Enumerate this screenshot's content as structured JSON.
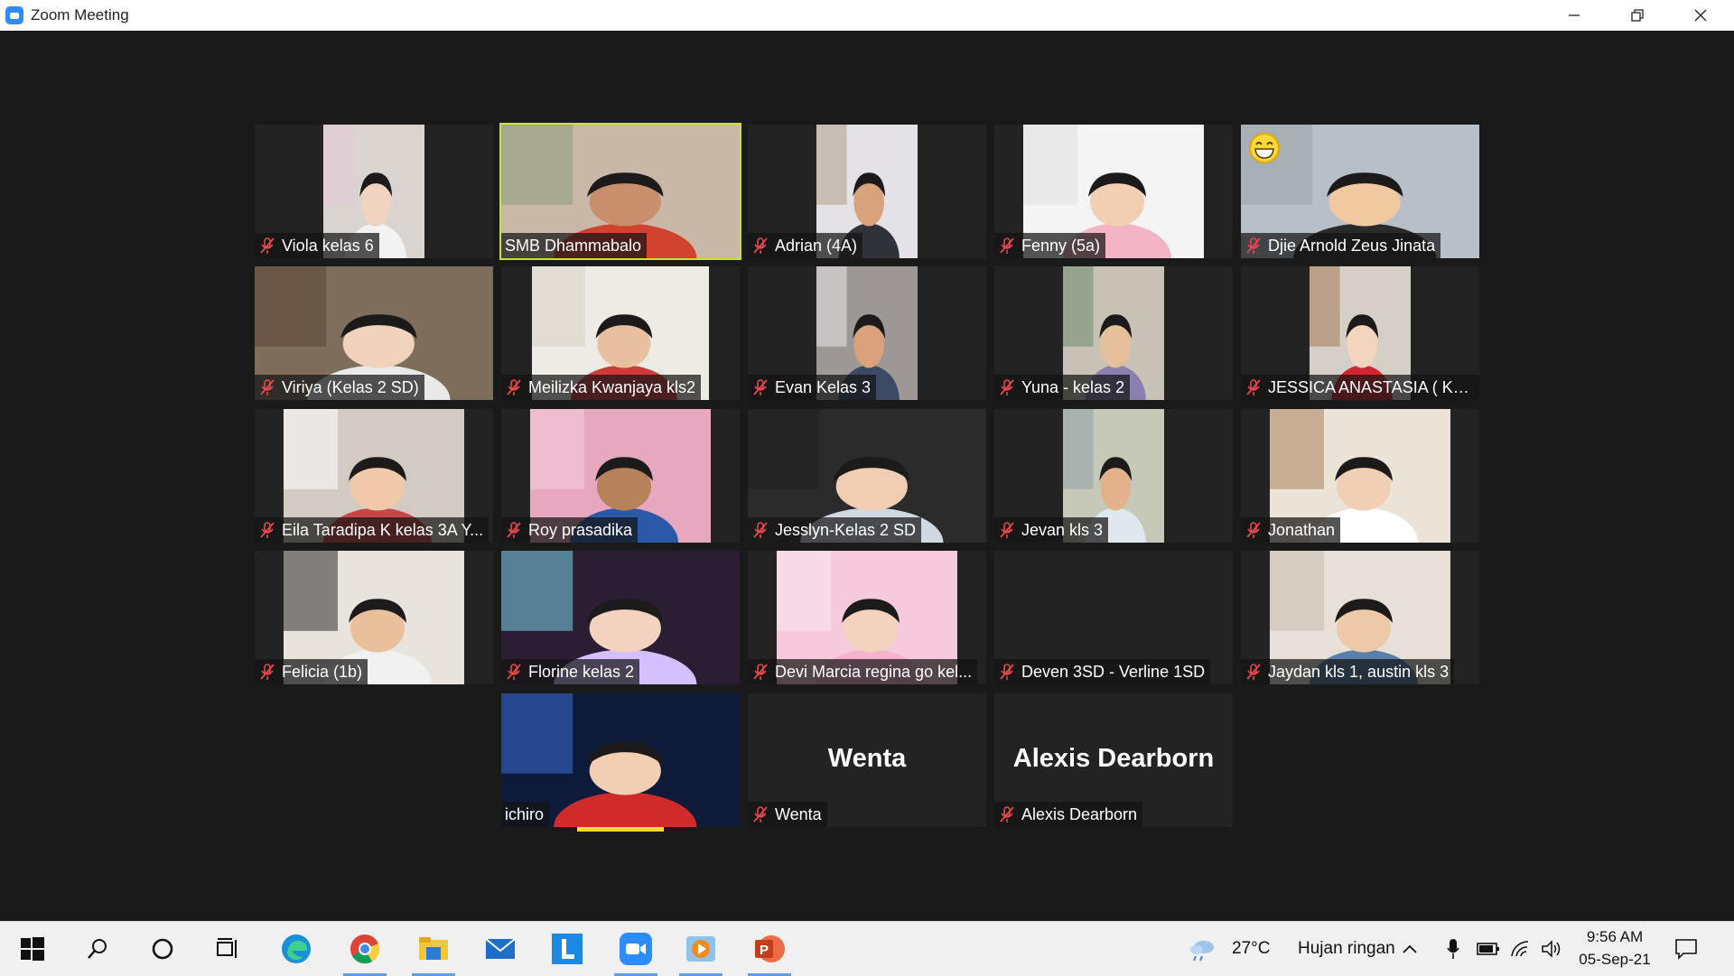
{
  "window": {
    "title": "Zoom Meeting"
  },
  "participants": [
    {
      "name": "Viola kelas 6",
      "muted": true,
      "video": true
    },
    {
      "name": "SMB Dhammabalo",
      "muted": false,
      "video": true,
      "active_speaker": true
    },
    {
      "name": "Adrian (4A)",
      "muted": true,
      "video": true
    },
    {
      "name": "Fenny (5a)",
      "muted": true,
      "video": true
    },
    {
      "name": "Djie Arnold Zeus Jinata",
      "muted": true,
      "video": true,
      "reaction": "grinning-face"
    },
    {
      "name": "Viriya (Kelas 2 SD)",
      "muted": true,
      "video": true
    },
    {
      "name": "Meilizka Kwanjaya kls2",
      "muted": true,
      "video": true
    },
    {
      "name": "Evan Kelas 3",
      "muted": true,
      "video": true
    },
    {
      "name": "Yuna - kelas 2",
      "muted": true,
      "video": true
    },
    {
      "name": "JESSICA ANASTASIA ( KLS...",
      "muted": true,
      "video": true
    },
    {
      "name": "Eila Taradipa K kelas 3A Y...",
      "muted": true,
      "video": true
    },
    {
      "name": "Roy prasadika",
      "muted": true,
      "video": true
    },
    {
      "name": "Jesslyn-Kelas 2 SD",
      "muted": true,
      "video": true
    },
    {
      "name": "Jevan kls 3",
      "muted": true,
      "video": true
    },
    {
      "name": "Jonathan",
      "muted": true,
      "video": true
    },
    {
      "name": "Felicia (1b)",
      "muted": true,
      "video": true
    },
    {
      "name": "Florine kelas 2",
      "muted": true,
      "video": true
    },
    {
      "name": "Devi Marcia regina go kel...",
      "muted": true,
      "video": true
    },
    {
      "name": "Deven 3SD - Verline 1SD",
      "muted": true,
      "video": false
    },
    {
      "name": "Jaydan kls 1, austin kls 3",
      "muted": true,
      "video": true
    },
    {
      "name": "ichiro",
      "muted": false,
      "video": true,
      "speaking": true
    },
    {
      "name": "Wenta",
      "muted": true,
      "video": false,
      "display_name": "Wenta"
    },
    {
      "name": "Alexis Dearborn",
      "muted": true,
      "video": false,
      "display_name": "Alexis Dearborn"
    }
  ],
  "taskbar": {
    "apps": [
      "windows-start",
      "search",
      "cortana",
      "task-view",
      "edge",
      "chrome",
      "file-explorer",
      "mail",
      "l-app",
      "zoom",
      "media-player",
      "powerpoint"
    ],
    "weather": {
      "temp": "27°C",
      "condition": "Hujan ringan"
    },
    "time": "9:56 AM",
    "date": "05-Sep-21"
  },
  "colors": {
    "active_speaker": "#c6e23a",
    "mute_icon": "#e5484d",
    "zoom_blue": "#2d8cff"
  }
}
